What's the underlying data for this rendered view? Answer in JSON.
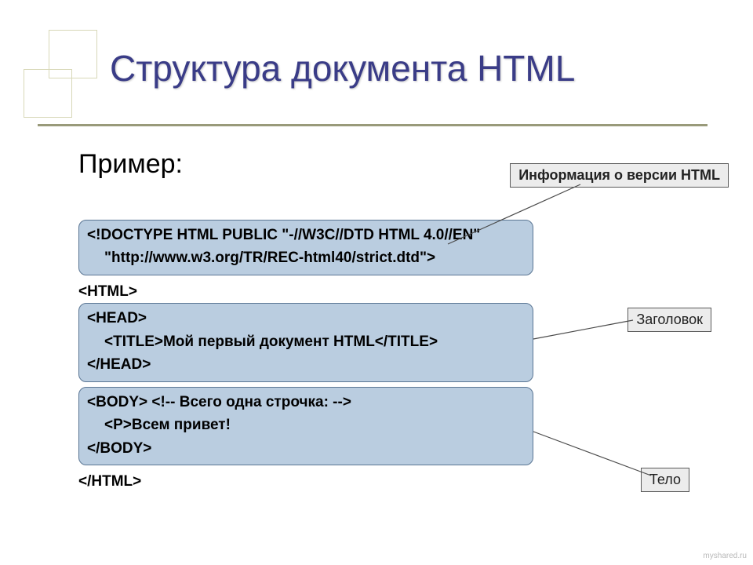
{
  "slide": {
    "title": "Структура документа HTML",
    "example_label": "Пример:"
  },
  "callouts": {
    "version": "Информация о версии HTML",
    "header": "Заголовок",
    "body": "Тело"
  },
  "code": {
    "doctype_line1": "<!DOCTYPE HTML PUBLIC \"-//W3C//DTD HTML 4.0//EN\"",
    "doctype_line2": "\"http://www.w3.org/TR/REC-html40/strict.dtd\">",
    "html_open": "<HTML>",
    "head_open": "<HEAD>",
    "title_line": "<TITLE>Мой первый документ HTML</TITLE>",
    "head_close": "</HEAD>",
    "body_open_line": "<BODY> <!-- Всего одна строчка: -->",
    "p_line": "<P>Всем привет!",
    "body_close": "</BODY>",
    "html_close": "</HTML>"
  },
  "watermark": "myshared.ru"
}
